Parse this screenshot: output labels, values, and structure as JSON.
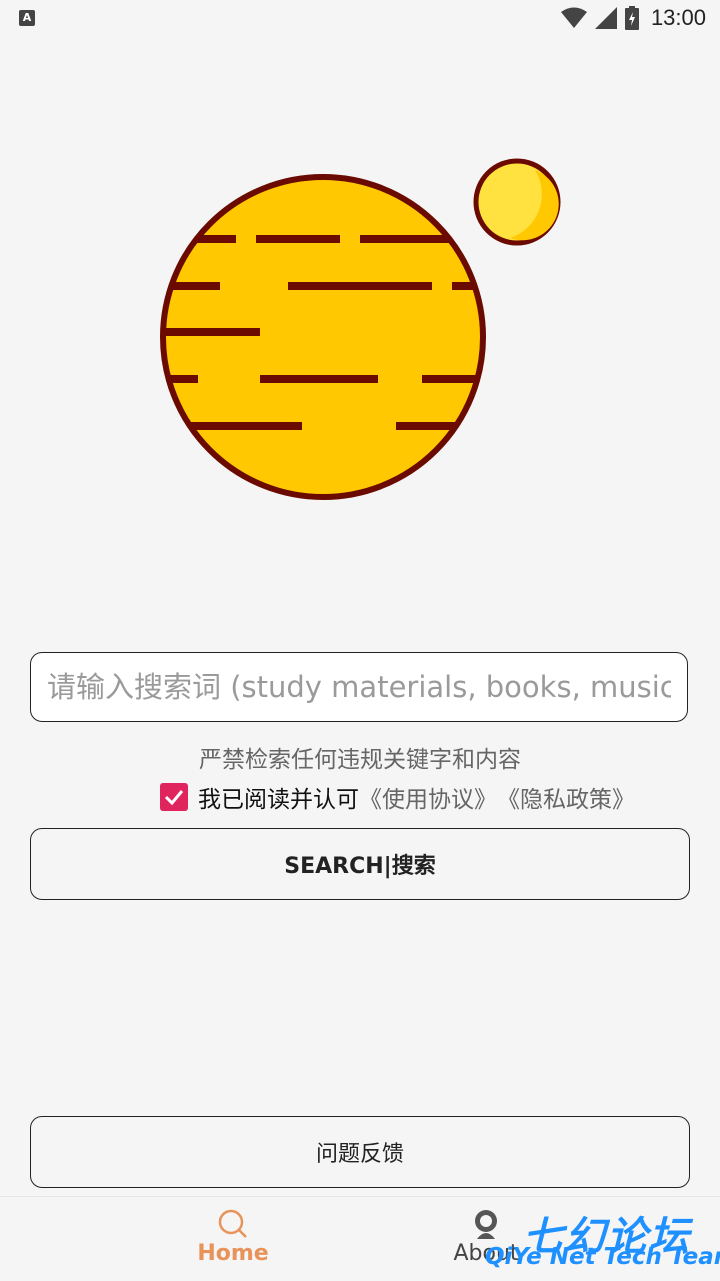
{
  "status_bar": {
    "app_icon_letter": "A",
    "time": "13:00"
  },
  "search": {
    "placeholder": "请输入搜索词 (study materials, books, music, videos)",
    "warning": "严禁检索任何违规关键字和内容"
  },
  "agreement": {
    "checked": true,
    "text": "我已阅读并认可",
    "terms_link": "《使用协议》",
    "privacy_link": "《隐私政策》"
  },
  "buttons": {
    "search": "SEARCH|搜索",
    "feedback": "问题反馈"
  },
  "nav": {
    "items": [
      {
        "label": "Home",
        "icon": "search-icon",
        "active": true
      },
      {
        "label": "About",
        "icon": "profile-icon",
        "active": false
      }
    ]
  },
  "watermark": {
    "cn": "七幻论坛",
    "en": "QiYe Net Tech Team"
  },
  "colors": {
    "accent": "#e8935a",
    "checkbox": "#e0245e",
    "planet": "#ffc800",
    "planet_stroke": "#6b0a00",
    "watermark": "#1e90ff"
  }
}
